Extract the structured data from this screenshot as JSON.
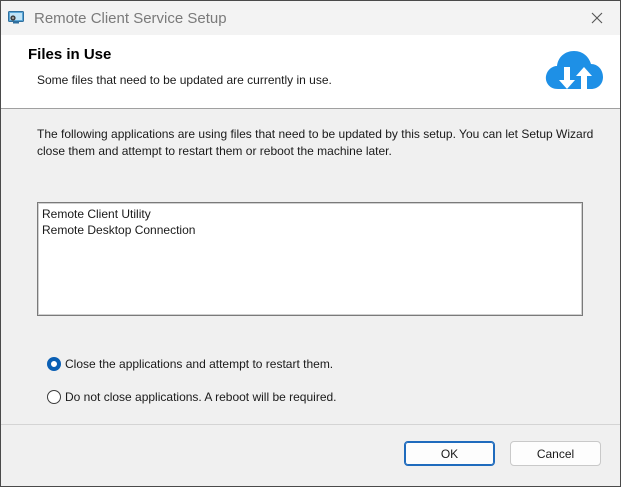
{
  "window": {
    "title": "Remote Client Service Setup"
  },
  "banner": {
    "title": "Files in Use",
    "subtitle": "Some files that need to be updated are currently in use.",
    "icon": "cloud-sync-icon"
  },
  "body": {
    "description": "The following applications are using files that need to be updated by this setup. You can let Setup Wizard close them and attempt to restart them or reboot the machine later.",
    "applications": [
      "Remote Client Utility",
      "Remote Desktop Connection"
    ],
    "options": [
      {
        "label": "Close the applications and attempt to restart them.",
        "selected": true
      },
      {
        "label": "Do not close applications. A reboot will be required.",
        "selected": false
      }
    ]
  },
  "footer": {
    "ok_label": "OK",
    "cancel_label": "Cancel"
  },
  "colors": {
    "accent": "#0a5fb4",
    "cloud": "#1e90e6"
  }
}
